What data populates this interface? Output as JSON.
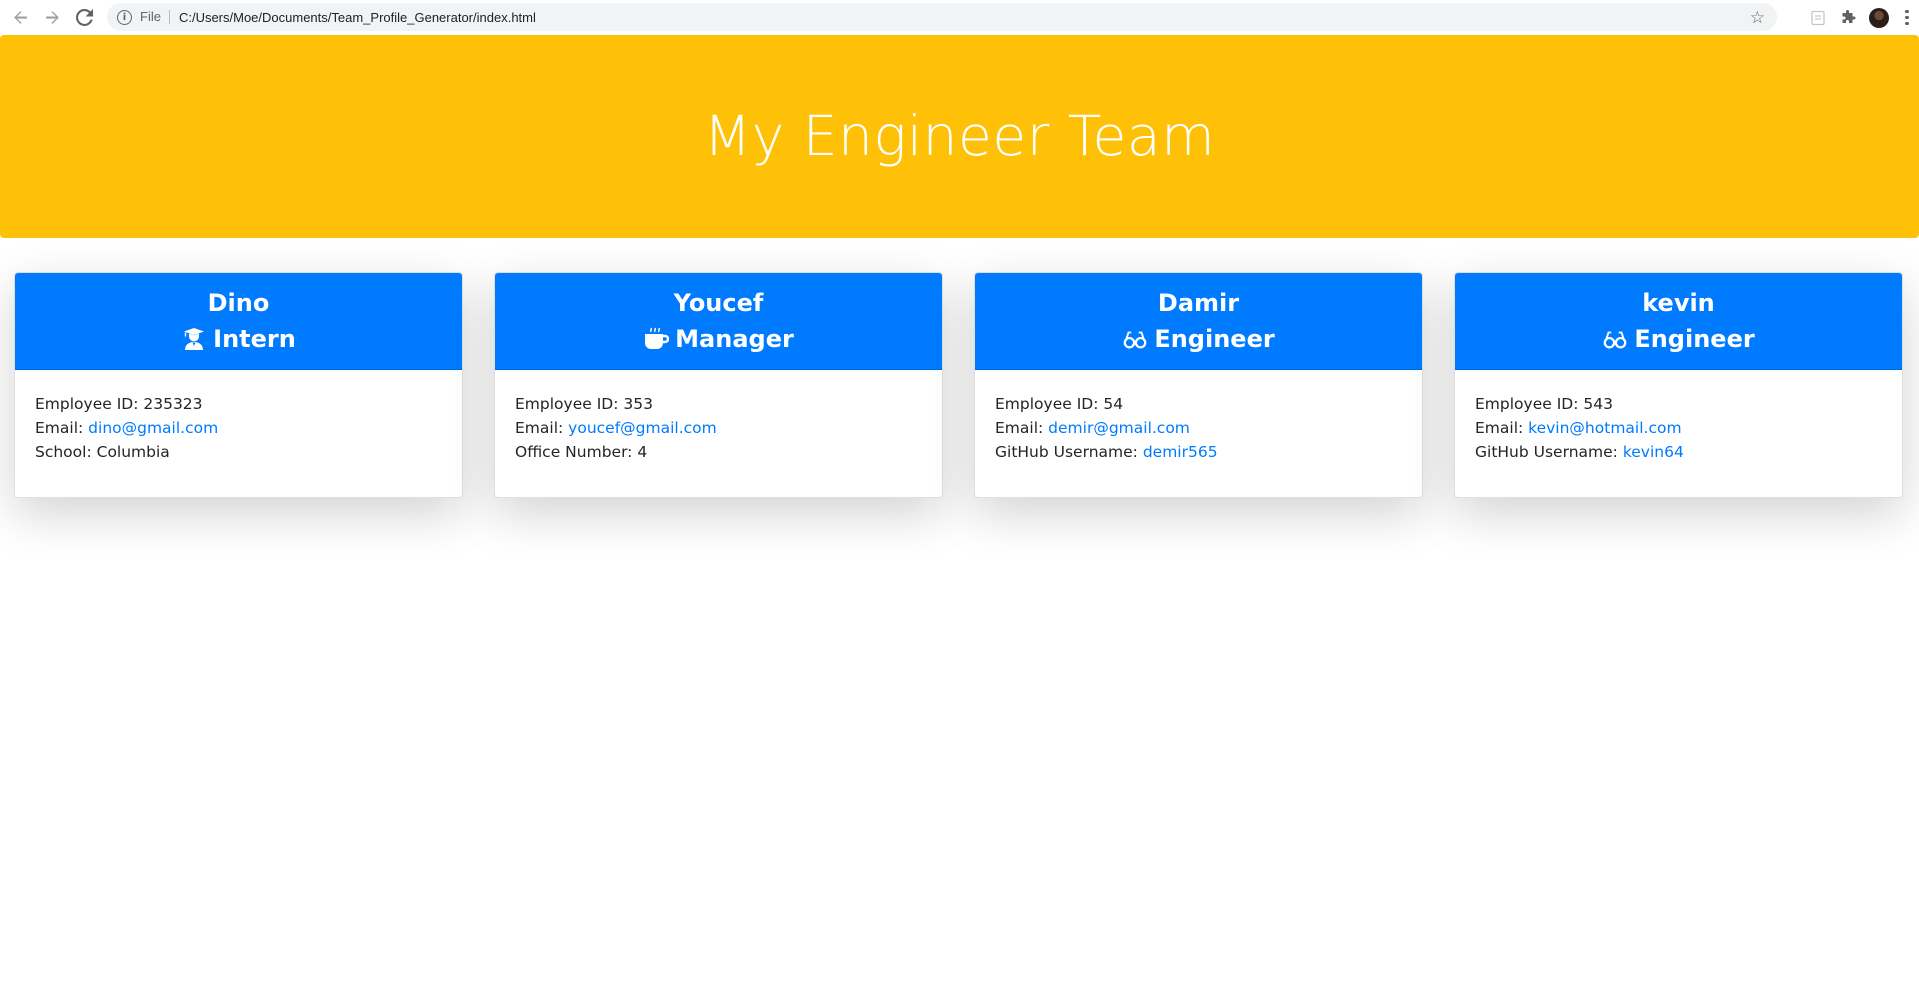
{
  "browser": {
    "file_label": "File",
    "url": "C:/Users/Moe/Documents/Team_Profile_Generator/index.html"
  },
  "page": {
    "title": "My Engineer Team"
  },
  "colors": {
    "header_bg": "#ffc107",
    "card_header_bg": "#007bff",
    "link": "#007bff"
  },
  "cards": [
    {
      "name": "Dino",
      "role": "Intern",
      "icon": "user-graduate-icon",
      "id_label": "Employee ID:",
      "id": "235323",
      "email_label": "Email:",
      "email": "dino@gmail.com",
      "extra_label": "School:",
      "extra_value": "Columbia"
    },
    {
      "name": "Youcef",
      "role": "Manager",
      "icon": "mug-icon",
      "id_label": "Employee ID:",
      "id": "353",
      "email_label": "Email:",
      "email": "youcef@gmail.com",
      "extra_label": "Office Number:",
      "extra_value": "4"
    },
    {
      "name": "Damir",
      "role": "Engineer",
      "icon": "glasses-icon",
      "id_label": "Employee ID:",
      "id": "54",
      "email_label": "Email:",
      "email": "demir@gmail.com",
      "extra_label": "GitHub Username:",
      "extra_value": "demir565"
    },
    {
      "name": "kevin",
      "role": "Engineer",
      "icon": "glasses-icon",
      "id_label": "Employee ID:",
      "id": "543",
      "email_label": "Email:",
      "email": "kevin@hotmail.com",
      "extra_label": "GitHub Username:",
      "extra_value": "kevin64"
    }
  ]
}
